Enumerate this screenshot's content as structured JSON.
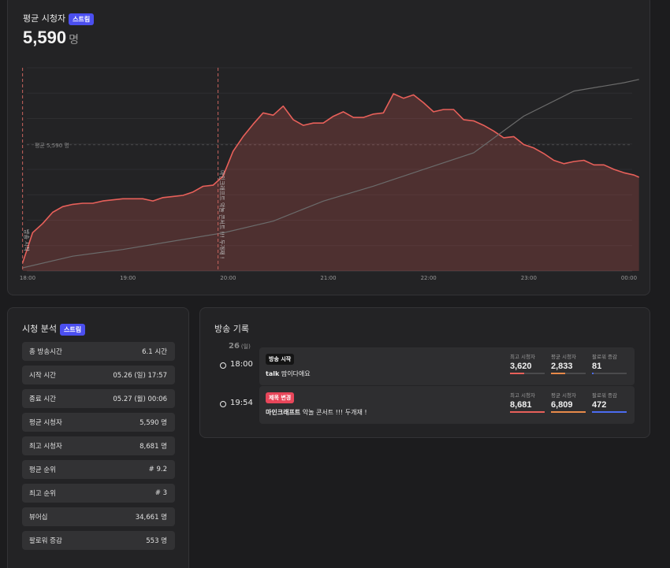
{
  "colors": {
    "viewers_line": "#e8605a",
    "followers_line": "#6b6b6b",
    "stream_badge": "#4b4ff0",
    "tag_start": "#141414",
    "tag_title_change": "#e8465a",
    "bar_red": "#e8605a",
    "bar_orange": "#e88a4a",
    "bar_blue": "#4b6bf0"
  },
  "summary": {
    "title": "평균 시청자",
    "badge": "스트림",
    "value": "5,590",
    "unit": "명"
  },
  "chart_data": {
    "type": "line",
    "x_ticks": [
      "18:00",
      "19:00",
      "20:00",
      "21:00",
      "22:00",
      "23:00",
      "00:00"
    ],
    "x_range": [
      "17:57",
      "00:06"
    ],
    "avg_line": {
      "label": "평균 5,590 명",
      "value": 5590
    },
    "ylim": [
      0,
      9000
    ],
    "grid": true,
    "markers": [
      {
        "x": "17:57",
        "label": "방송 시작"
      },
      {
        "x": "19:54",
        "label": "마인크래프트 악놀 콘서트 !!! 두개재 !"
      }
    ],
    "series": [
      {
        "role": "viewers",
        "x": [
          "17:57",
          "18:03",
          "18:09",
          "18:15",
          "18:21",
          "18:27",
          "18:33",
          "18:39",
          "18:45",
          "18:51",
          "18:57",
          "19:03",
          "19:09",
          "19:15",
          "19:21",
          "19:27",
          "19:33",
          "19:39",
          "19:45",
          "19:51",
          "19:57",
          "20:03",
          "20:09",
          "20:15",
          "20:21",
          "20:27",
          "20:33",
          "20:39",
          "20:45",
          "20:51",
          "20:57",
          "21:03",
          "21:09",
          "21:15",
          "21:21",
          "21:27",
          "21:33",
          "21:39",
          "21:45",
          "21:51",
          "21:57",
          "22:03",
          "22:09",
          "22:15",
          "22:21",
          "22:27",
          "22:33",
          "22:39",
          "22:45",
          "22:51",
          "22:57",
          "23:03",
          "23:09",
          "23:15",
          "23:21",
          "23:27",
          "23:33",
          "23:39",
          "23:45",
          "23:51",
          "23:57",
          "00:03",
          "00:06"
        ],
        "values": [
          350,
          1700,
          2100,
          2600,
          2850,
          2950,
          3000,
          3000,
          3100,
          3150,
          3200,
          3200,
          3200,
          3100,
          3250,
          3300,
          3350,
          3500,
          3750,
          3800,
          4200,
          5300,
          5950,
          6500,
          7000,
          6900,
          7300,
          6700,
          6450,
          6550,
          6550,
          6850,
          7050,
          6800,
          6800,
          6950,
          7000,
          7850,
          7650,
          7800,
          7450,
          7050,
          7150,
          7150,
          6700,
          6650,
          6450,
          6200,
          5900,
          5950,
          5600,
          5450,
          5200,
          4900,
          4750,
          4850,
          4900,
          4700,
          4700,
          4500,
          4350,
          4250,
          4150
        ]
      },
      {
        "role": "followers",
        "x": [
          "17:57",
          "18:27",
          "18:57",
          "19:27",
          "19:57",
          "20:27",
          "20:57",
          "21:27",
          "21:57",
          "22:27",
          "22:57",
          "23:27",
          "23:57",
          "00:06"
        ],
        "values": [
          0,
          35,
          55,
          80,
          105,
          140,
          200,
          245,
          295,
          345,
          455,
          530,
          555,
          565
        ]
      }
    ]
  },
  "analysis": {
    "title": "시청 분석",
    "badge": "스트림",
    "rows": [
      {
        "label": "총 방송시간",
        "value": "6.1 시간"
      },
      {
        "label": "시작 시간",
        "value": "05.26 (일) 17:57"
      },
      {
        "label": "종료 시간",
        "value": "05.27 (월) 00:06"
      },
      {
        "label": "평균 시청자",
        "value": "5,590 명"
      },
      {
        "label": "최고 시청자",
        "value": "8,681 명"
      },
      {
        "label": "평균 순위",
        "value": "# 9.2"
      },
      {
        "label": "최고 순위",
        "value": "# 3"
      },
      {
        "label": "뷰어십",
        "value": "34,661 명"
      },
      {
        "label": "팔로워 증감",
        "value": "553 명"
      }
    ]
  },
  "log": {
    "title": "방송 기록",
    "date_day": "26",
    "date_weekday": "(일)",
    "events": [
      {
        "time": "18:00",
        "tag": "방송 시작",
        "title_bold": "talk",
        "title_rest": " 땀이다애요",
        "metrics": [
          {
            "label": "최고 시청자",
            "value": "3,620",
            "fill": 0.42
          },
          {
            "label": "평균 시청자",
            "value": "2,833",
            "fill": 0.4
          },
          {
            "label": "팔로워 증감",
            "value": "81",
            "fill": 0.05
          }
        ]
      },
      {
        "time": "19:54",
        "tag": "제목 변경",
        "title_bold": "마인크래프트",
        "title_rest": " 악놀 콘서트 !!! 두개재 !",
        "metrics": [
          {
            "label": "최고 시청자",
            "value": "8,681",
            "fill": 1.0
          },
          {
            "label": "평균 시청자",
            "value": "6,809",
            "fill": 1.0
          },
          {
            "label": "팔로워 증감",
            "value": "472",
            "fill": 1.0
          }
        ]
      }
    ]
  }
}
